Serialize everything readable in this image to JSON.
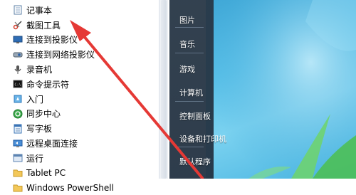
{
  "programs": [
    {
      "label": "记事本",
      "icon": "notepad-icon"
    },
    {
      "label": "截图工具",
      "icon": "snipping-tool-icon"
    },
    {
      "label": "连接到投影仪",
      "icon": "projector-icon"
    },
    {
      "label": "连接到网络投影仪",
      "icon": "network-projector-icon"
    },
    {
      "label": "录音机",
      "icon": "microphone-icon"
    },
    {
      "label": "命令提示符",
      "icon": "cmd-icon"
    },
    {
      "label": "入门",
      "icon": "getting-started-icon"
    },
    {
      "label": "同步中心",
      "icon": "sync-center-icon"
    },
    {
      "label": "写字板",
      "icon": "wordpad-icon"
    },
    {
      "label": "远程桌面连接",
      "icon": "remote-desktop-icon"
    },
    {
      "label": "运行",
      "icon": "run-icon"
    },
    {
      "label": "Tablet PC",
      "icon": "folder-icon"
    },
    {
      "label": "Windows PowerShell",
      "icon": "folder-icon"
    }
  ],
  "right_menu": [
    {
      "label": "图片"
    },
    {
      "label": "音乐"
    },
    {
      "label": "游戏"
    },
    {
      "label": "计算机"
    },
    {
      "label": "控制面板"
    },
    {
      "label": "设备和打印机"
    },
    {
      "label": "默认程序"
    }
  ],
  "colors": {
    "annotation_arrow": "#e53935",
    "menu_dark": "#33465a",
    "desktop": "#4fb8e3"
  }
}
